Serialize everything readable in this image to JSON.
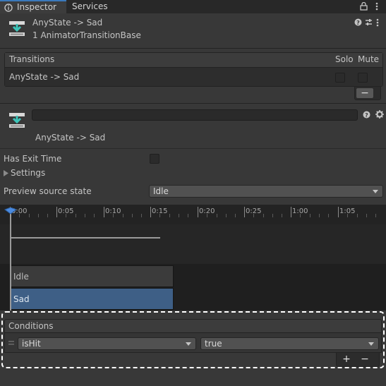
{
  "tabs": [
    {
      "label": "Inspector"
    },
    {
      "label": "Services"
    }
  ],
  "header": {
    "title": "AnyState -> Sad",
    "subtitle": "1 AnimatorTransitionBase"
  },
  "transitions": {
    "title": "Transitions",
    "solo_label": "Solo",
    "mute_label": "Mute",
    "rows": [
      {
        "label": "AnyState -> Sad",
        "solo": false,
        "mute": false
      }
    ],
    "remove_label": "−"
  },
  "transition": {
    "name_value": "",
    "label": "AnyState -> Sad"
  },
  "settings": {
    "has_exit_time_label": "Has Exit Time",
    "has_exit_time": false,
    "settings_label": "Settings",
    "preview_label": "Preview source state",
    "preview_value": "Idle"
  },
  "timeline": {
    "ticks": [
      "0:00",
      "0:05",
      "0:10",
      "0:15",
      "0:20",
      "0:25",
      "1:00",
      "1:05"
    ],
    "tracks": [
      {
        "label": "Idle"
      },
      {
        "label": "Sad"
      }
    ]
  },
  "conditions": {
    "title": "Conditions",
    "rows": [
      {
        "parameter": "isHit",
        "value": "true"
      }
    ],
    "add_label": "+",
    "remove_label": "−"
  },
  "colors": {
    "accent": "#3a79bb",
    "selected_track": "#3e5f86"
  }
}
